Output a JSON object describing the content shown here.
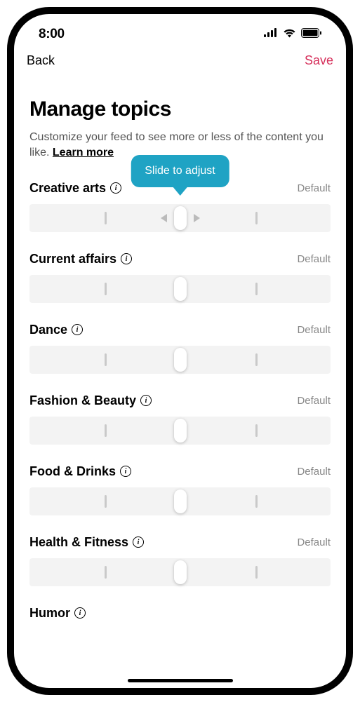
{
  "status": {
    "time": "8:00"
  },
  "nav": {
    "back": "Back",
    "save": "Save"
  },
  "header": {
    "title": "Manage topics",
    "subtitle_prefix": "Customize your feed to see more or less of the content you like. ",
    "learn_more": "Learn more"
  },
  "tooltip": "Slide to adjust",
  "topics": [
    {
      "name": "Creative arts",
      "status": "Default",
      "show_tooltip": true,
      "show_arrows": true
    },
    {
      "name": "Current affairs",
      "status": "Default",
      "show_tooltip": false,
      "show_arrows": false
    },
    {
      "name": "Dance",
      "status": "Default",
      "show_tooltip": false,
      "show_arrows": false
    },
    {
      "name": "Fashion & Beauty",
      "status": "Default",
      "show_tooltip": false,
      "show_arrows": false
    },
    {
      "name": "Food & Drinks",
      "status": "Default",
      "show_tooltip": false,
      "show_arrows": false
    },
    {
      "name": "Health & Fitness",
      "status": "Default",
      "show_tooltip": false,
      "show_arrows": false
    },
    {
      "name": "Humor",
      "status": "",
      "show_tooltip": false,
      "show_arrows": false
    }
  ]
}
